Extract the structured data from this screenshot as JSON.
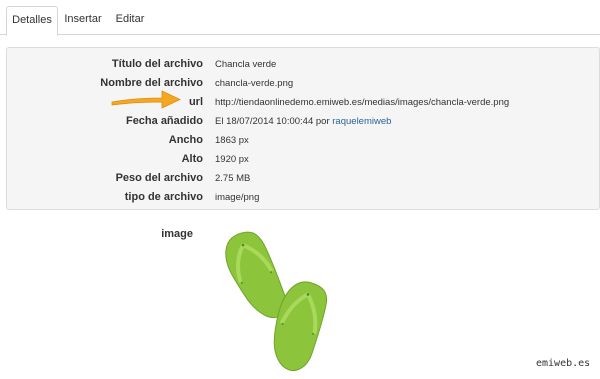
{
  "tabs": [
    {
      "label": "Detalles",
      "active": true
    },
    {
      "label": "Insertar",
      "active": false
    },
    {
      "label": "Editar",
      "active": false
    }
  ],
  "details": [
    {
      "label": "Título del archivo",
      "value": "Chancla verde"
    },
    {
      "label": "Nombre del archivo",
      "value": "chancla-verde.png"
    },
    {
      "label": "url",
      "value": "http://tiendaonlinedemo.emiweb.es/medias/images/chancla-verde.png"
    },
    {
      "label": "Fecha añadido",
      "value": "El 18/07/2014 10:00:44 por ",
      "user": "raquelemiweb"
    },
    {
      "label": "Ancho",
      "value": "1863 px"
    },
    {
      "label": "Alto",
      "value": "1920 px"
    },
    {
      "label": "Peso del archivo",
      "value": "2.75 MB"
    },
    {
      "label": "tipo de archivo",
      "value": "image/png"
    }
  ],
  "image": {
    "label": "image"
  },
  "watermark": "emiweb.es",
  "colors": {
    "arrow": "#f5a623",
    "link": "#2a6496",
    "flipflop": "#8cc43c",
    "panel_bg": "#f5f5f5"
  }
}
